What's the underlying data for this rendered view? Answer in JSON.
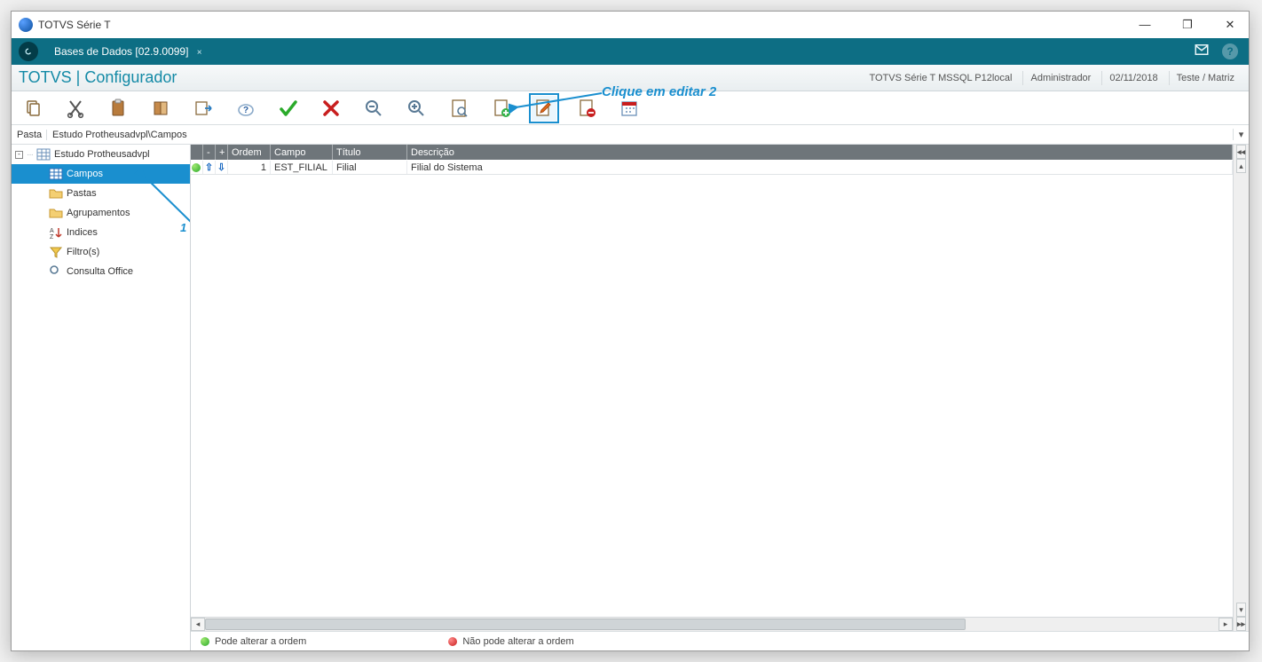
{
  "window": {
    "title": "TOTVS Série T"
  },
  "ribbon": {
    "tab_label": "Bases de Dados [02.9.0099]"
  },
  "header": {
    "module": "TOTVS | Configurador",
    "status": {
      "env": "TOTVS Série T  MSSQL P12local",
      "user": "Administrador",
      "date": "02/11/2018",
      "branch": "Teste / Matriz"
    }
  },
  "annotations": {
    "edit_hint": "Clique em editar 2",
    "num1": "1"
  },
  "path": {
    "label": "Pasta",
    "value": "Estudo Protheusadvpl\\Campos"
  },
  "tree": {
    "root": "Estudo Protheusadvpl",
    "items": [
      {
        "label": "Campos"
      },
      {
        "label": "Pastas"
      },
      {
        "label": "Agrupamentos"
      },
      {
        "label": "Indices"
      },
      {
        "label": "Filtro(s)"
      },
      {
        "label": "Consulta Office"
      }
    ]
  },
  "grid": {
    "headers": {
      "minus": "-",
      "plus": "+",
      "ordem": "Ordem",
      "campo": "Campo",
      "titulo": "Título",
      "descricao": "Descrição"
    },
    "rows": [
      {
        "ordem": "1",
        "campo": "EST_FILIAL",
        "titulo": "Filial",
        "descricao": "Filial do Sistema"
      }
    ]
  },
  "footer": {
    "legend_ok": "Pode alterar a ordem",
    "legend_no": "Não pode alterar a ordem"
  }
}
